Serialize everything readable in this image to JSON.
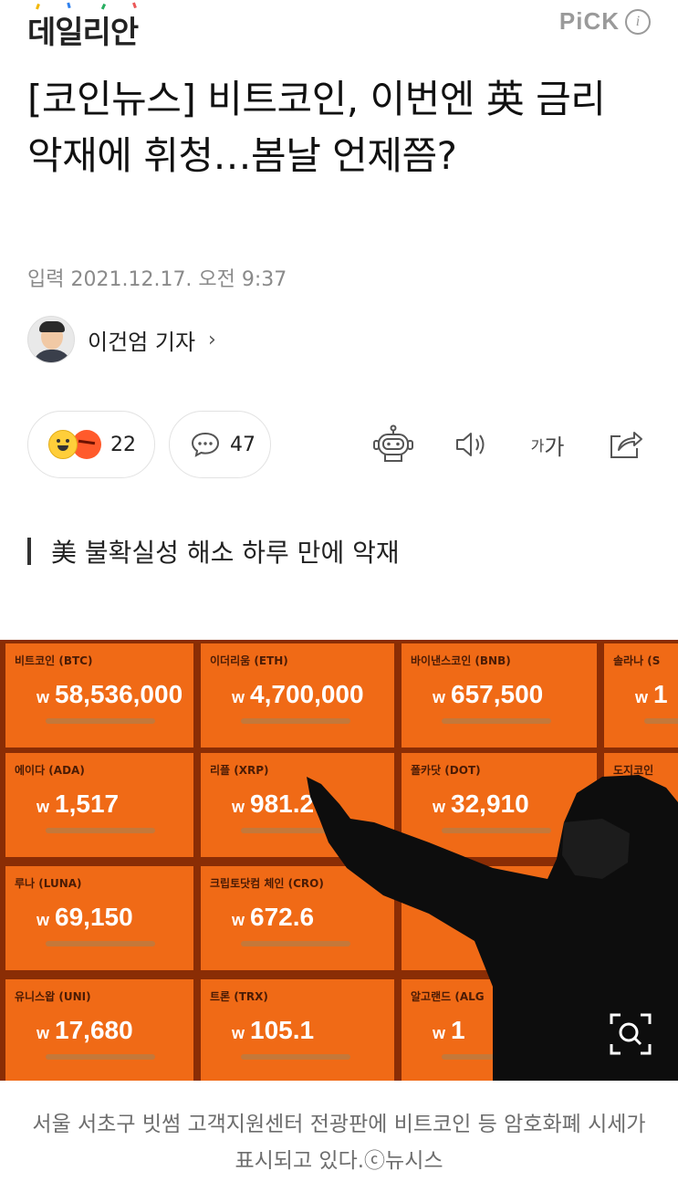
{
  "header": {
    "logo_text": "데일리안",
    "pick_label": "PiCK",
    "info_label": "i"
  },
  "article": {
    "headline": "[코인뉴스] 비트코인, 이번엔 英 금리 악재에 휘청…봄날 언제쯤?",
    "dateline": "입력 2021.12.17. 오전 9:37",
    "reporter": "이건엄 기자",
    "reporter_chevron": "›",
    "subheading": "美 불확실성 해소 하루 만에 악재"
  },
  "reactions": {
    "reaction_count": "22",
    "comment_count": "47",
    "font_size_label_small": "가",
    "font_size_label_large": "가"
  },
  "photo": {
    "won_symbol": "w",
    "tiles": [
      {
        "label": "비트코인 (BTC)",
        "price": "58,536,000"
      },
      {
        "label": "이더리움 (ETH)",
        "price": "4,700,000"
      },
      {
        "label": "바이낸스코인 (BNB)",
        "price": "657,500"
      },
      {
        "label": "솔라나 (S",
        "price": "1"
      },
      {
        "label": "에이다 (ADA)",
        "price": "1,517"
      },
      {
        "label": "리플 (XRP)",
        "price": "981.2"
      },
      {
        "label": "폴카닷 (DOT)",
        "price": "32,910"
      },
      {
        "label": "도지코인",
        "price": ""
      },
      {
        "label": "루나 (LUNA)",
        "price": "69,150"
      },
      {
        "label": "크립토닷컴 체인 (CRO)",
        "price": "672.6"
      },
      {
        "label": "",
        "price": ""
      },
      {
        "label": "",
        "price": ""
      },
      {
        "label": "유니스왑 (UNI)",
        "price": "17,680"
      },
      {
        "label": "트론 (TRX)",
        "price": "105.1"
      },
      {
        "label": "알고랜드 (ALG",
        "price": "1"
      },
      {
        "label": "",
        "price": ""
      }
    ],
    "caption": "서울 서초구 빗썸 고객지원센터 전광판에 비트코인 등 암호화폐 시세가 표시되고 있다.ⓒ뉴시스"
  },
  "colors": {
    "tile_orange": "#f06a16",
    "grid_line": "#8a2d05",
    "caption_gray": "#6d6d6d",
    "pick_gray": "#9a9a9a"
  }
}
